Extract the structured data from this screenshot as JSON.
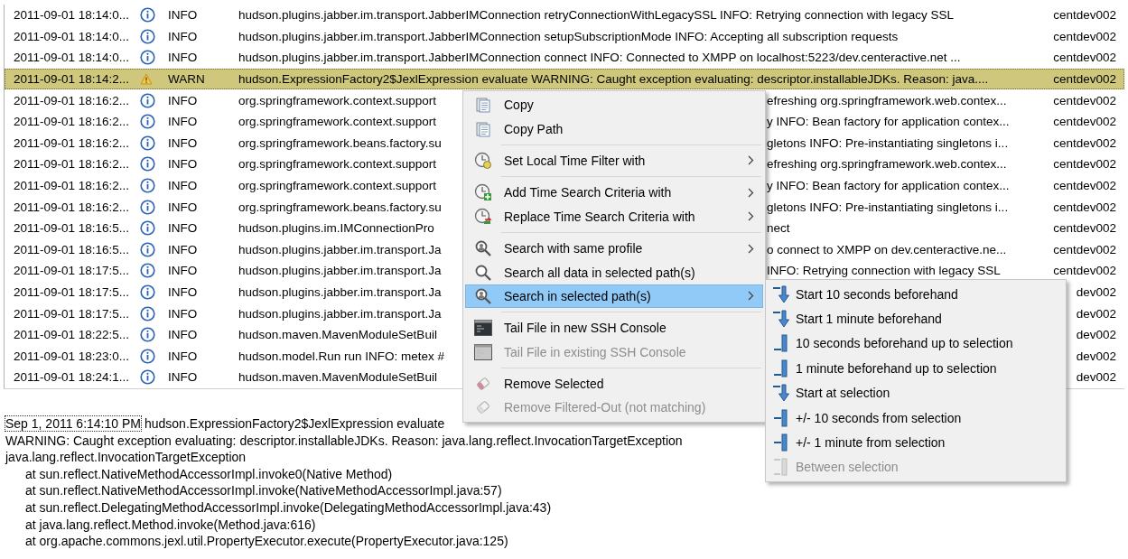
{
  "log_table": {
    "rows": [
      {
        "time": "2011-09-01 18:14:0...",
        "kind": "info",
        "severity": "INFO",
        "message": "hudson.plugins.jabber.im.transport.JabberIMConnection retryConnectionWithLegacySSL INFO: Retrying connection with legacy SSL",
        "host": "centdev002",
        "selected": false
      },
      {
        "time": "2011-09-01 18:14:0...",
        "kind": "info",
        "severity": "INFO",
        "message": "hudson.plugins.jabber.im.transport.JabberIMConnection setupSubscriptionMode INFO: Accepting all subscription requests",
        "host": "centdev002",
        "selected": false
      },
      {
        "time": "2011-09-01 18:14:0...",
        "kind": "info",
        "severity": "INFO",
        "message": "hudson.plugins.jabber.im.transport.JabberIMConnection connect INFO: Connected to XMPP on localhost:5223/dev.centeractive.net ...",
        "host": "centdev002",
        "selected": false
      },
      {
        "time": "2011-09-01 18:14:2...",
        "kind": "warn",
        "severity": "WARN",
        "message": "hudson.ExpressionFactory2$JexlExpression evaluate WARNING: Caught exception evaluating: descriptor.installableJDKs. Reason: java....",
        "host": "centdev002",
        "selected": true
      },
      {
        "time": "2011-09-01 18:16:2...",
        "kind": "info",
        "severity": "INFO",
        "message": "org.springframework.context.support",
        "message_tail": "efreshing org.springframework.web.contex...",
        "host": "centdev002",
        "selected": false
      },
      {
        "time": "2011-09-01 18:16:2...",
        "kind": "info",
        "severity": "INFO",
        "message": "org.springframework.context.support",
        "message_tail": "y INFO: Bean factory for application contex...",
        "host": "centdev002",
        "selected": false
      },
      {
        "time": "2011-09-01 18:16:2...",
        "kind": "info",
        "severity": "INFO",
        "message": "org.springframework.beans.factory.su",
        "message_tail": "gletons INFO: Pre-instantiating singletons i...",
        "host": "centdev002",
        "selected": false
      },
      {
        "time": "2011-09-01 18:16:2...",
        "kind": "info",
        "severity": "INFO",
        "message": "org.springframework.context.support",
        "message_tail": "efreshing org.springframework.web.contex...",
        "host": "centdev002",
        "selected": false
      },
      {
        "time": "2011-09-01 18:16:2...",
        "kind": "info",
        "severity": "INFO",
        "message": "org.springframework.context.support",
        "message_tail": "y INFO: Bean factory for application contex...",
        "host": "centdev002",
        "selected": false
      },
      {
        "time": "2011-09-01 18:16:2...",
        "kind": "info",
        "severity": "INFO",
        "message": "org.springframework.beans.factory.su",
        "message_tail": "gletons INFO: Pre-instantiating singletons i...",
        "host": "centdev002",
        "selected": false
      },
      {
        "time": "2011-09-01 18:16:5...",
        "kind": "info",
        "severity": "INFO",
        "message": "hudson.plugins.im.IMConnectionPro",
        "message_tail": "nect",
        "host": "centdev002",
        "selected": false
      },
      {
        "time": "2011-09-01 18:16:5...",
        "kind": "info",
        "severity": "INFO",
        "message": "hudson.plugins.jabber.im.transport.Ja",
        "message_tail": "o connect to XMPP on dev.centeractive.ne...",
        "host": "centdev002",
        "selected": false
      },
      {
        "time": "2011-09-01 18:17:5...",
        "kind": "info",
        "severity": "INFO",
        "message": "hudson.plugins.jabber.im.transport.Ja",
        "message_tail": "INFO: Retrying connection with legacy SSL",
        "host": "centdev002",
        "selected": false
      },
      {
        "time": "2011-09-01 18:17:5...",
        "kind": "info",
        "severity": "INFO",
        "message": "hudson.plugins.jabber.im.transport.Ja",
        "host": "dev002",
        "selected": false
      },
      {
        "time": "2011-09-01 18:17:5...",
        "kind": "info",
        "severity": "INFO",
        "message": "hudson.plugins.jabber.im.transport.Ja",
        "host": "dev002",
        "selected": false
      },
      {
        "time": "2011-09-01 18:22:5...",
        "kind": "info",
        "severity": "INFO",
        "message": "hudson.maven.MavenModuleSetBuil",
        "host": "dev002",
        "selected": false
      },
      {
        "time": "2011-09-01 18:23:0...",
        "kind": "info",
        "severity": "INFO",
        "message": "hudson.model.Run run INFO: metex #",
        "host": "dev002",
        "selected": false
      },
      {
        "time": "2011-09-01 18:24:1...",
        "kind": "info",
        "severity": "INFO",
        "message": "hudson.maven.MavenModuleSetBuil",
        "host": "dev002",
        "selected": false
      }
    ]
  },
  "detail": {
    "timestamp": "Sep 1, 2011 6:14:10 PM",
    "heading": "hudson.ExpressionFactory2$JexlExpression evaluate",
    "lines": [
      {
        "text": "WARNING: Caught exception evaluating: descriptor.installableJDKs. Reason: java.lang.reflect.InvocationTargetException",
        "indented": false
      },
      {
        "text": "java.lang.reflect.InvocationTargetException",
        "indented": false
      },
      {
        "text": "at sun.reflect.NativeMethodAccessorImpl.invoke0(Native Method)",
        "indented": true
      },
      {
        "text": "at sun.reflect.NativeMethodAccessorImpl.invoke(NativeMethodAccessorImpl.java:57)",
        "indented": true
      },
      {
        "text": "at sun.reflect.DelegatingMethodAccessorImpl.invoke(DelegatingMethodAccessorImpl.java:43)",
        "indented": true
      },
      {
        "text": "at java.lang.reflect.Method.invoke(Method.java:616)",
        "indented": true
      },
      {
        "text": "at org.apache.commons.jexl.util.PropertyExecutor.execute(PropertyExecutor.java:125)",
        "indented": true
      }
    ]
  },
  "context_menu": {
    "groups": [
      [
        {
          "label": "Copy",
          "has_submenu": false,
          "disabled": false,
          "selected": false
        },
        {
          "label": "Copy Path",
          "has_submenu": false,
          "disabled": false,
          "selected": false
        }
      ],
      [
        {
          "label": "Set Local Time Filter with",
          "has_submenu": true,
          "disabled": false,
          "selected": false
        }
      ],
      [
        {
          "label": "Add Time Search Criteria with",
          "has_submenu": true,
          "disabled": false,
          "selected": false
        },
        {
          "label": "Replace Time Search Criteria with",
          "has_submenu": true,
          "disabled": false,
          "selected": false
        }
      ],
      [
        {
          "label": "Search with same profile",
          "has_submenu": true,
          "disabled": false,
          "selected": false
        },
        {
          "label": "Search all data in selected path(s)",
          "has_submenu": false,
          "disabled": false,
          "selected": false
        },
        {
          "label": "Search in selected path(s)",
          "has_submenu": true,
          "disabled": false,
          "selected": true
        }
      ],
      [
        {
          "label": "Tail File in new SSH Console",
          "has_submenu": false,
          "disabled": false,
          "selected": false
        },
        {
          "label": "Tail File in existing SSH Console",
          "has_submenu": false,
          "disabled": true,
          "selected": false
        }
      ],
      [
        {
          "label": "Remove Selected",
          "has_submenu": false,
          "disabled": false,
          "selected": false
        },
        {
          "label": "Remove Filtered-Out (not matching)",
          "has_submenu": false,
          "disabled": true,
          "selected": false
        }
      ]
    ]
  },
  "submenu": {
    "items": [
      {
        "label": "Start 10 seconds beforehand",
        "kind": "start",
        "disabled": false
      },
      {
        "label": "Start 1 minute beforehand",
        "kind": "start",
        "disabled": false
      },
      {
        "label": "10 seconds beforehand up to selection",
        "kind": "upto",
        "disabled": false
      },
      {
        "label": "1 minute beforehand up to selection",
        "kind": "upto",
        "disabled": false
      },
      {
        "label": "Start at selection",
        "kind": "start",
        "disabled": false
      },
      {
        "label": "+/- 10 seconds from selection",
        "kind": "around",
        "disabled": false
      },
      {
        "label": "+/- 1 minute from selection",
        "kind": "around",
        "disabled": false
      },
      {
        "label": "Between selection",
        "kind": "between",
        "disabled": true
      }
    ]
  }
}
